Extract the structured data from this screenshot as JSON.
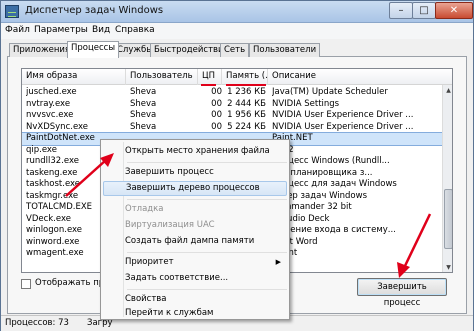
{
  "window": {
    "title": "Диспетчер задач Windows",
    "min": "–",
    "max": "□",
    "close": "✕"
  },
  "menu": [
    "Файл",
    "Параметры",
    "Вид",
    "Справка"
  ],
  "tabs": [
    "Приложения",
    "Процессы",
    "Службы",
    "Быстродействие",
    "Сеть",
    "Пользователи"
  ],
  "active_tab": "Процессы",
  "columns": {
    "name": "Имя образа",
    "user": "Пользователь",
    "cpu": "ЦП",
    "mem": "Память (...",
    "desc": "Описание"
  },
  "rows": [
    {
      "name": "jusched.exe",
      "user": "Sheva",
      "cpu": "00",
      "mem": "1 236 КБ",
      "desc": "Java(TM) Update Scheduler"
    },
    {
      "name": "nvtray.exe",
      "user": "Sheva",
      "cpu": "00",
      "mem": "2 444 КБ",
      "desc": "NVIDIA Settings"
    },
    {
      "name": "nvvsvc.exe",
      "user": "Sheva",
      "cpu": "00",
      "mem": "1 956 КБ",
      "desc": "NVIDIA User Experience Driver ..."
    },
    {
      "name": "NvXDSync.exe",
      "user": "Sheva",
      "cpu": "00",
      "mem": "5 224 КБ",
      "desc": "NVIDIA User Experience Driver ..."
    },
    {
      "name": "PaintDotNet.exe",
      "user": "",
      "cpu": "",
      "mem": "",
      "desc": "Paint.NET"
    },
    {
      "name": "qip.exe",
      "user": "",
      "cpu": "",
      "mem": "",
      "desc": "2012"
    },
    {
      "name": "rundll32.exe",
      "user": "",
      "cpu": "",
      "mem": "",
      "desc": "процесс Windows (Rundll..."
    },
    {
      "name": "taskeng.exe",
      "user": "",
      "cpu": "",
      "mem": "",
      "desc": "чик планировщика з..."
    },
    {
      "name": "taskhost.exe",
      "user": "",
      "cpu": "",
      "mem": "",
      "desc": "процесс для задач Windows"
    },
    {
      "name": "taskmgr.exe",
      "user": "",
      "cpu": "",
      "mem": "",
      "desc": "етчер задач Windows"
    },
    {
      "name": "TOTALCMD.EXE",
      "user": "",
      "cpu": "",
      "mem": "",
      "desc": "Commander 32 bit"
    },
    {
      "name": "VDeck.exe",
      "user": "",
      "cpu": "",
      "mem": "",
      "desc": "D Audio Deck"
    },
    {
      "name": "winlogon.exe",
      "user": "",
      "cpu": "",
      "mem": "",
      "desc": "ложение входа в систему..."
    },
    {
      "name": "winword.exe",
      "user": "",
      "cpu": "",
      "mem": "",
      "desc": "osoft Word"
    },
    {
      "name": "wmagent.exe",
      "user": "",
      "cpu": "",
      "mem": "",
      "desc": "Agent"
    }
  ],
  "show_all_label": "Отображать процесс",
  "end_process_label": "Завершить процесс",
  "status": {
    "processes": "Процессов: 73",
    "cpu": "Загру"
  },
  "context_menu": {
    "items": [
      {
        "label": "Открыть место хранения файла",
        "state": "normal"
      },
      {
        "label": "Завершить процесс",
        "state": "normal"
      },
      {
        "label": "Завершить дерево процессов",
        "state": "highlighted"
      },
      {
        "label": "Отладка",
        "state": "disabled"
      },
      {
        "label": "Виртуализация UAC",
        "state": "disabled"
      },
      {
        "label": "Создать файл дампа памяти",
        "state": "normal"
      },
      {
        "label": "Приоритет",
        "state": "submenu"
      },
      {
        "label": "Задать соответствие...",
        "state": "normal"
      },
      {
        "label": "Свойства",
        "state": "normal"
      },
      {
        "label": "Перейти к службам",
        "state": "normal"
      }
    ],
    "submenu_arrow": "▶"
  },
  "scroll": {
    "up": "▲",
    "down": "▼"
  },
  "colors": {
    "annotation_red": "#e0001a",
    "selection": "#cfe4fa"
  }
}
